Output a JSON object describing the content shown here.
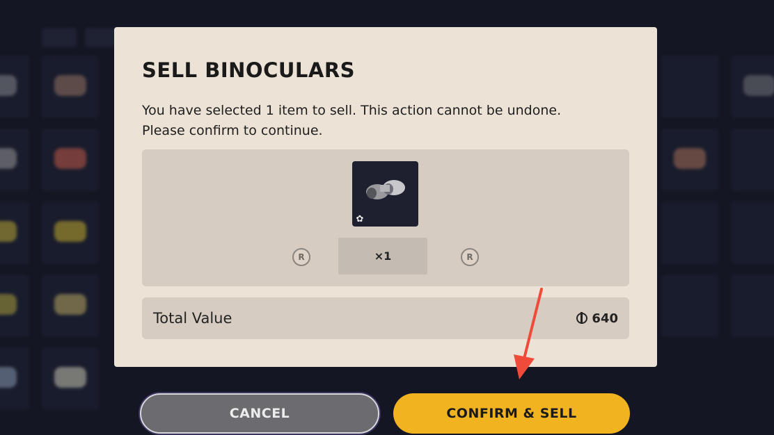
{
  "dialog": {
    "title": "SELL BINOCULARS",
    "message_line1": "You have selected 1 item to sell. This action cannot be undone.",
    "message_line2": "Please confirm to continue.",
    "item": {
      "icon": "binoculars-icon",
      "badge_icon": "gear-icon"
    },
    "quantity": "×1",
    "decrease_glyph": "R",
    "increase_glyph": "R",
    "total_label": "Total Value",
    "total_value": "640",
    "currency_icon": "coin-icon"
  },
  "buttons": {
    "cancel": "CANCEL",
    "confirm": "CONFIRM & SELL"
  },
  "colors": {
    "dialog_bg": "#ece2d6",
    "panel_bg": "#d6ccc2",
    "confirm": "#f1b320",
    "cancel": "#6c6c70",
    "annotation_arrow": "#f04b3a"
  }
}
